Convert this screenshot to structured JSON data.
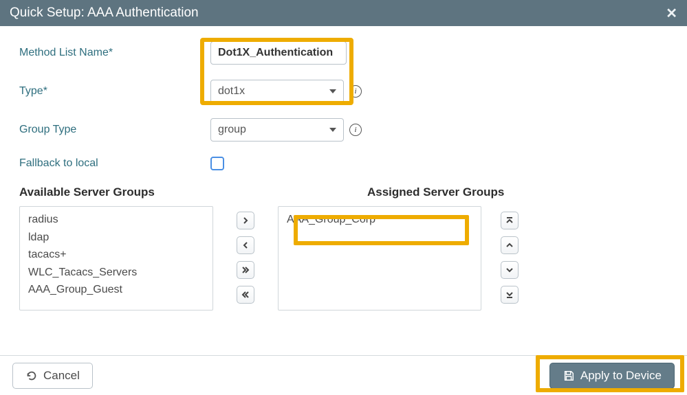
{
  "titlebar": {
    "title": "Quick Setup: AAA Authentication"
  },
  "labels": {
    "method_list_name": "Method List Name*",
    "type": "Type*",
    "group_type": "Group Type",
    "fallback": "Fallback to local",
    "available": "Available Server Groups",
    "assigned": "Assigned Server Groups"
  },
  "values": {
    "method_list_name": "Dot1X_Authentication",
    "type": "dot1x",
    "group_type": "group"
  },
  "available_groups": [
    "radius",
    "ldap",
    "tacacs+",
    "WLC_Tacacs_Servers",
    "AAA_Group_Guest"
  ],
  "assigned_groups": [
    "AAA_Group_Corp"
  ],
  "buttons": {
    "cancel": "Cancel",
    "apply": "Apply to Device"
  }
}
